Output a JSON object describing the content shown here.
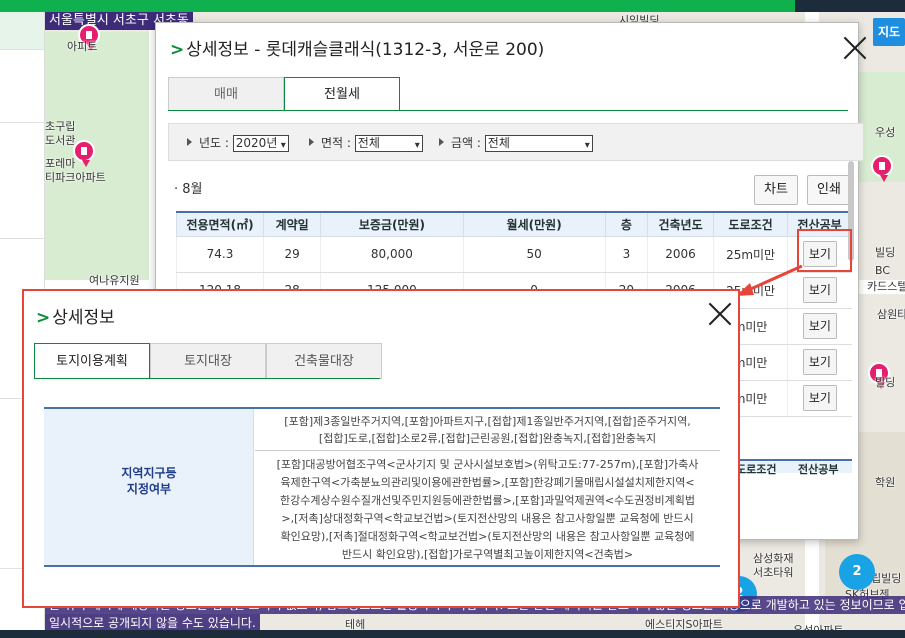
{
  "map": {
    "title_strip": "서울특별시 서초구 서초동",
    "labels": [
      "아피트",
      "초구립",
      "도서관",
      "포레마",
      "티파크아파트",
      "여나유지원",
      "시임빌딩",
      "우성",
      "빌딩",
      "BC",
      "카드스텔",
      "삼원타",
      "빌딩",
      "학원",
      "삼성화재",
      "서초타워",
      "SK허브젠",
      "에스티지S아파트",
      "우성아파트",
      "립빌딩",
      "테헤"
    ],
    "cluster_a": "2",
    "cluster_b": "2",
    "map_button": "지도",
    "notice_line1": "는 위의 예시에 해당하는 정보는 법적인 효력이 없으며, 참고용으로만 활용하시기 바랍니다. 또한 관련 데이터를 완료하지 않은 정보를 대상으로 개발하고 있는 정보이므로 입법하여 공개하기 때문에 전산상의",
    "notice_line2": "일시적으로 공개되지 않을 수도 있습니다."
  },
  "dialog1": {
    "title": "상세정보 - 롯데캐슬클래식(1312-3, 서운로 200)",
    "tabs": [
      "매매",
      "전월세"
    ],
    "active_tab": "전월세",
    "filter": {
      "year_label": "년도 :",
      "year_value": "2020년",
      "area_label": "면적 :",
      "area_value": "전체",
      "amount_label": "금액 :",
      "amount_value": "전체"
    },
    "month": "8월",
    "chart_button": "차트",
    "print_button": "인쇄",
    "columns": [
      "전용면적(㎡)",
      "계약일",
      "보증금(만원)",
      "월세(만원)",
      "층",
      "건축년도",
      "도로조건",
      "전산공부"
    ],
    "rows": [
      {
        "area": "74.3",
        "day": "29",
        "deposit": "80,000",
        "rent": "50",
        "floor": "3",
        "year": "2006",
        "road": "25m미만",
        "btn": "보기"
      },
      {
        "area": "120.18",
        "day": "28",
        "deposit": "125,000",
        "rent": "0",
        "floor": "20",
        "year": "2006",
        "road": "25m미만",
        "btn": "보기"
      },
      {
        "area": "",
        "day": "",
        "deposit": "",
        "rent": "",
        "floor": "",
        "year": "",
        "road": "m미만",
        "btn": "보기"
      },
      {
        "area": "",
        "day": "",
        "deposit": "",
        "rent": "",
        "floor": "",
        "year": "",
        "road": "m미만",
        "btn": "보기"
      },
      {
        "area": "",
        "day": "",
        "deposit": "",
        "rent": "",
        "floor": "",
        "year": "",
        "road": "m미만",
        "btn": "보기"
      }
    ],
    "lower_header_fragment": "도로조건",
    "lower_header_fragment2": "전산공부"
  },
  "dialog2": {
    "title": "상세정보",
    "tabs": [
      "토지이용계획",
      "토지대장",
      "건축물대장"
    ],
    "active_tab": "토지이용계획",
    "row_header_line1": "지역지구등",
    "row_header_line2": "지정여부",
    "cell1_line1": "[포함]제3종일반주거지역,[포함]아파트지구,[접합]제1종일반주거지역,[접합]준주거지역,",
    "cell1_line2": "[접합]도로,[접합]소로2류,[접합]근린공원,[접합]완충녹지,[접합]완충녹지",
    "cell2_line1": "[포함]대공방어협조구역<군사기지 및 군사시설보호법>(위탁고도:77-257m),[포함]가축사",
    "cell2_line2": "육제한구역<가축분뇨의관리및이용에관한법률>,[포함]한강폐기물매립시설설치제한지역<",
    "cell2_line3": "한강수계상수원수질개선및주민지원등에관한법률>,[포함]과밀억제권역<수도권정비계획법",
    "cell2_line4": ">,[저촉]상대정화구역<학교보건법>(토지전산망의 내용은 참고사항일뿐 교육청에 반드시",
    "cell2_line5": "확인요망),[저촉]절대정화구역<학교보건법>(토지전산망의 내용은 참고사항일뿐 교육청에",
    "cell2_line6": "반드시 확인요망),[접합]가로구역별최고높이제한지역<건축법>"
  },
  "colors": {
    "accent_green": "#0a8a3c",
    "highlight_red": "#e8443a",
    "table_head": "#e9f1fa",
    "map_pin": "#e61e6e"
  }
}
